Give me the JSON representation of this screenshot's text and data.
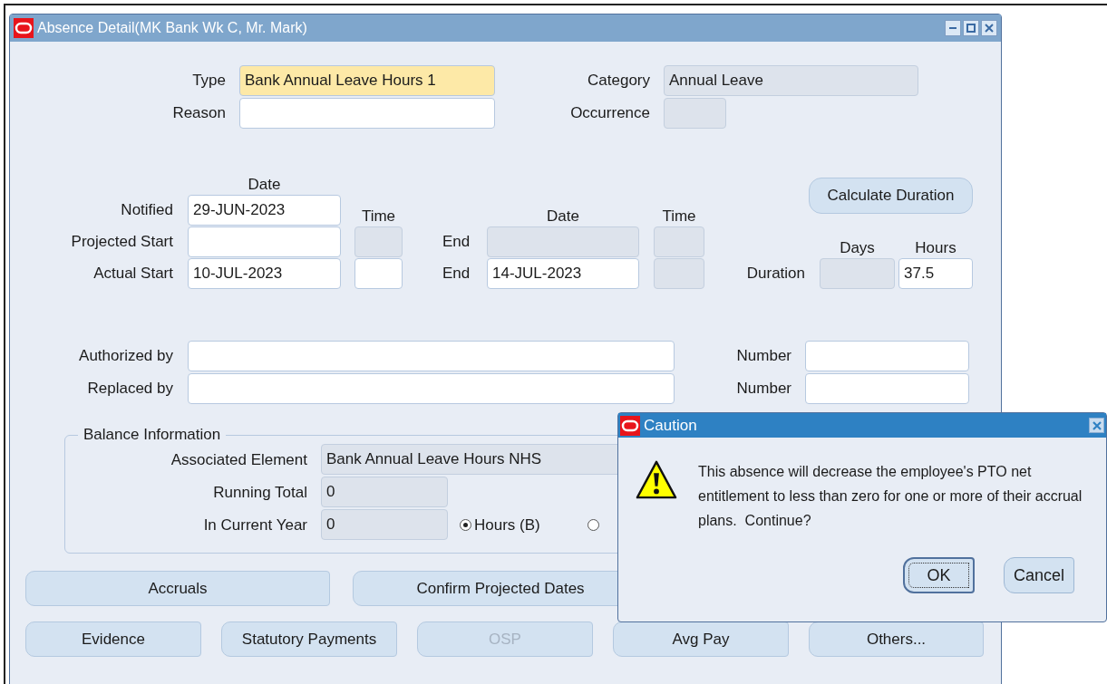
{
  "window": {
    "title": "Absence  Detail(MK Bank Wk C, Mr. Mark)",
    "active": false
  },
  "type": {
    "label": "Type",
    "value": "Bank Annual Leave Hours 1",
    "current": true
  },
  "reason": {
    "label": "Reason",
    "disabled": false
  },
  "category": {
    "label": "Category",
    "value": "Annual Leave",
    "disabled": true
  },
  "occurrence": {
    "label": "Occurrence",
    "disabled": true
  },
  "dates": {
    "date_heading": "Date",
    "time_heading": "Time",
    "end_date_heading": "Date",
    "end_time_heading": "Time",
    "rows": [
      {
        "label": "Notified",
        "date": {
          "value": "29-JUN-2023",
          "disabled": false
        }
      },
      {
        "label": "Projected Start",
        "date": {
          "disabled": false
        },
        "time": {
          "disabled": true
        },
        "end_label": "End",
        "end_date": {
          "disabled": true
        },
        "end_time": {
          "disabled": true
        }
      },
      {
        "label": "Actual Start",
        "date": {
          "value": "10-JUL-2023",
          "disabled": false
        },
        "time": {
          "disabled": false
        },
        "end_label": "End",
        "end_date": {
          "value": "14-JUL-2023",
          "disabled": false
        },
        "end_time": {
          "disabled": true
        }
      }
    ]
  },
  "calculate_button": "Calculate Duration",
  "duration": {
    "label": "Duration",
    "days_heading": "Days",
    "hours_heading": "Hours",
    "days": {
      "disabled": true
    },
    "hours": {
      "value": "37.5",
      "disabled": false
    }
  },
  "authorization": [
    {
      "label": "Authorized by",
      "disabled": false,
      "number_label": "Number",
      "number": {
        "disabled": false
      }
    },
    {
      "label": "Replaced by",
      "disabled": false,
      "number_label": "Number",
      "number": {
        "disabled": false
      }
    }
  ],
  "balance": {
    "title": "Balance Information",
    "associated_element": {
      "label": "Associated Element",
      "value": "Bank Annual Leave Hours NHS",
      "disabled": true
    },
    "running_total": {
      "label": "Running Total",
      "value": "0",
      "disabled": true
    },
    "current_year": {
      "label": "In Current Year",
      "value": "0",
      "disabled": true
    },
    "units": [
      {
        "label": "Hours (B)",
        "selected": true
      },
      {
        "selected": false
      }
    ]
  },
  "buttons": [
    [
      {
        "label": "Accruals",
        "disabled": false
      },
      {
        "label": "Confirm Projected Dates",
        "disabled": false
      }
    ],
    [
      {
        "label": "Evidence",
        "disabled": false
      },
      {
        "label": "Statutory Payments",
        "disabled": false
      },
      {
        "label": "OSP",
        "disabled": true
      },
      {
        "label": "Avg Pay",
        "disabled": false
      },
      {
        "label": "Others...",
        "disabled": false
      }
    ]
  ],
  "dialog": {
    "title": "Caution",
    "message": "This absence will decrease the employee's PTO net entitlement to less than zero for one or more of their accrual plans.  Continue?",
    "buttons": [
      {
        "label": "OK",
        "default": true
      },
      {
        "label": "Cancel",
        "default": false
      }
    ]
  }
}
